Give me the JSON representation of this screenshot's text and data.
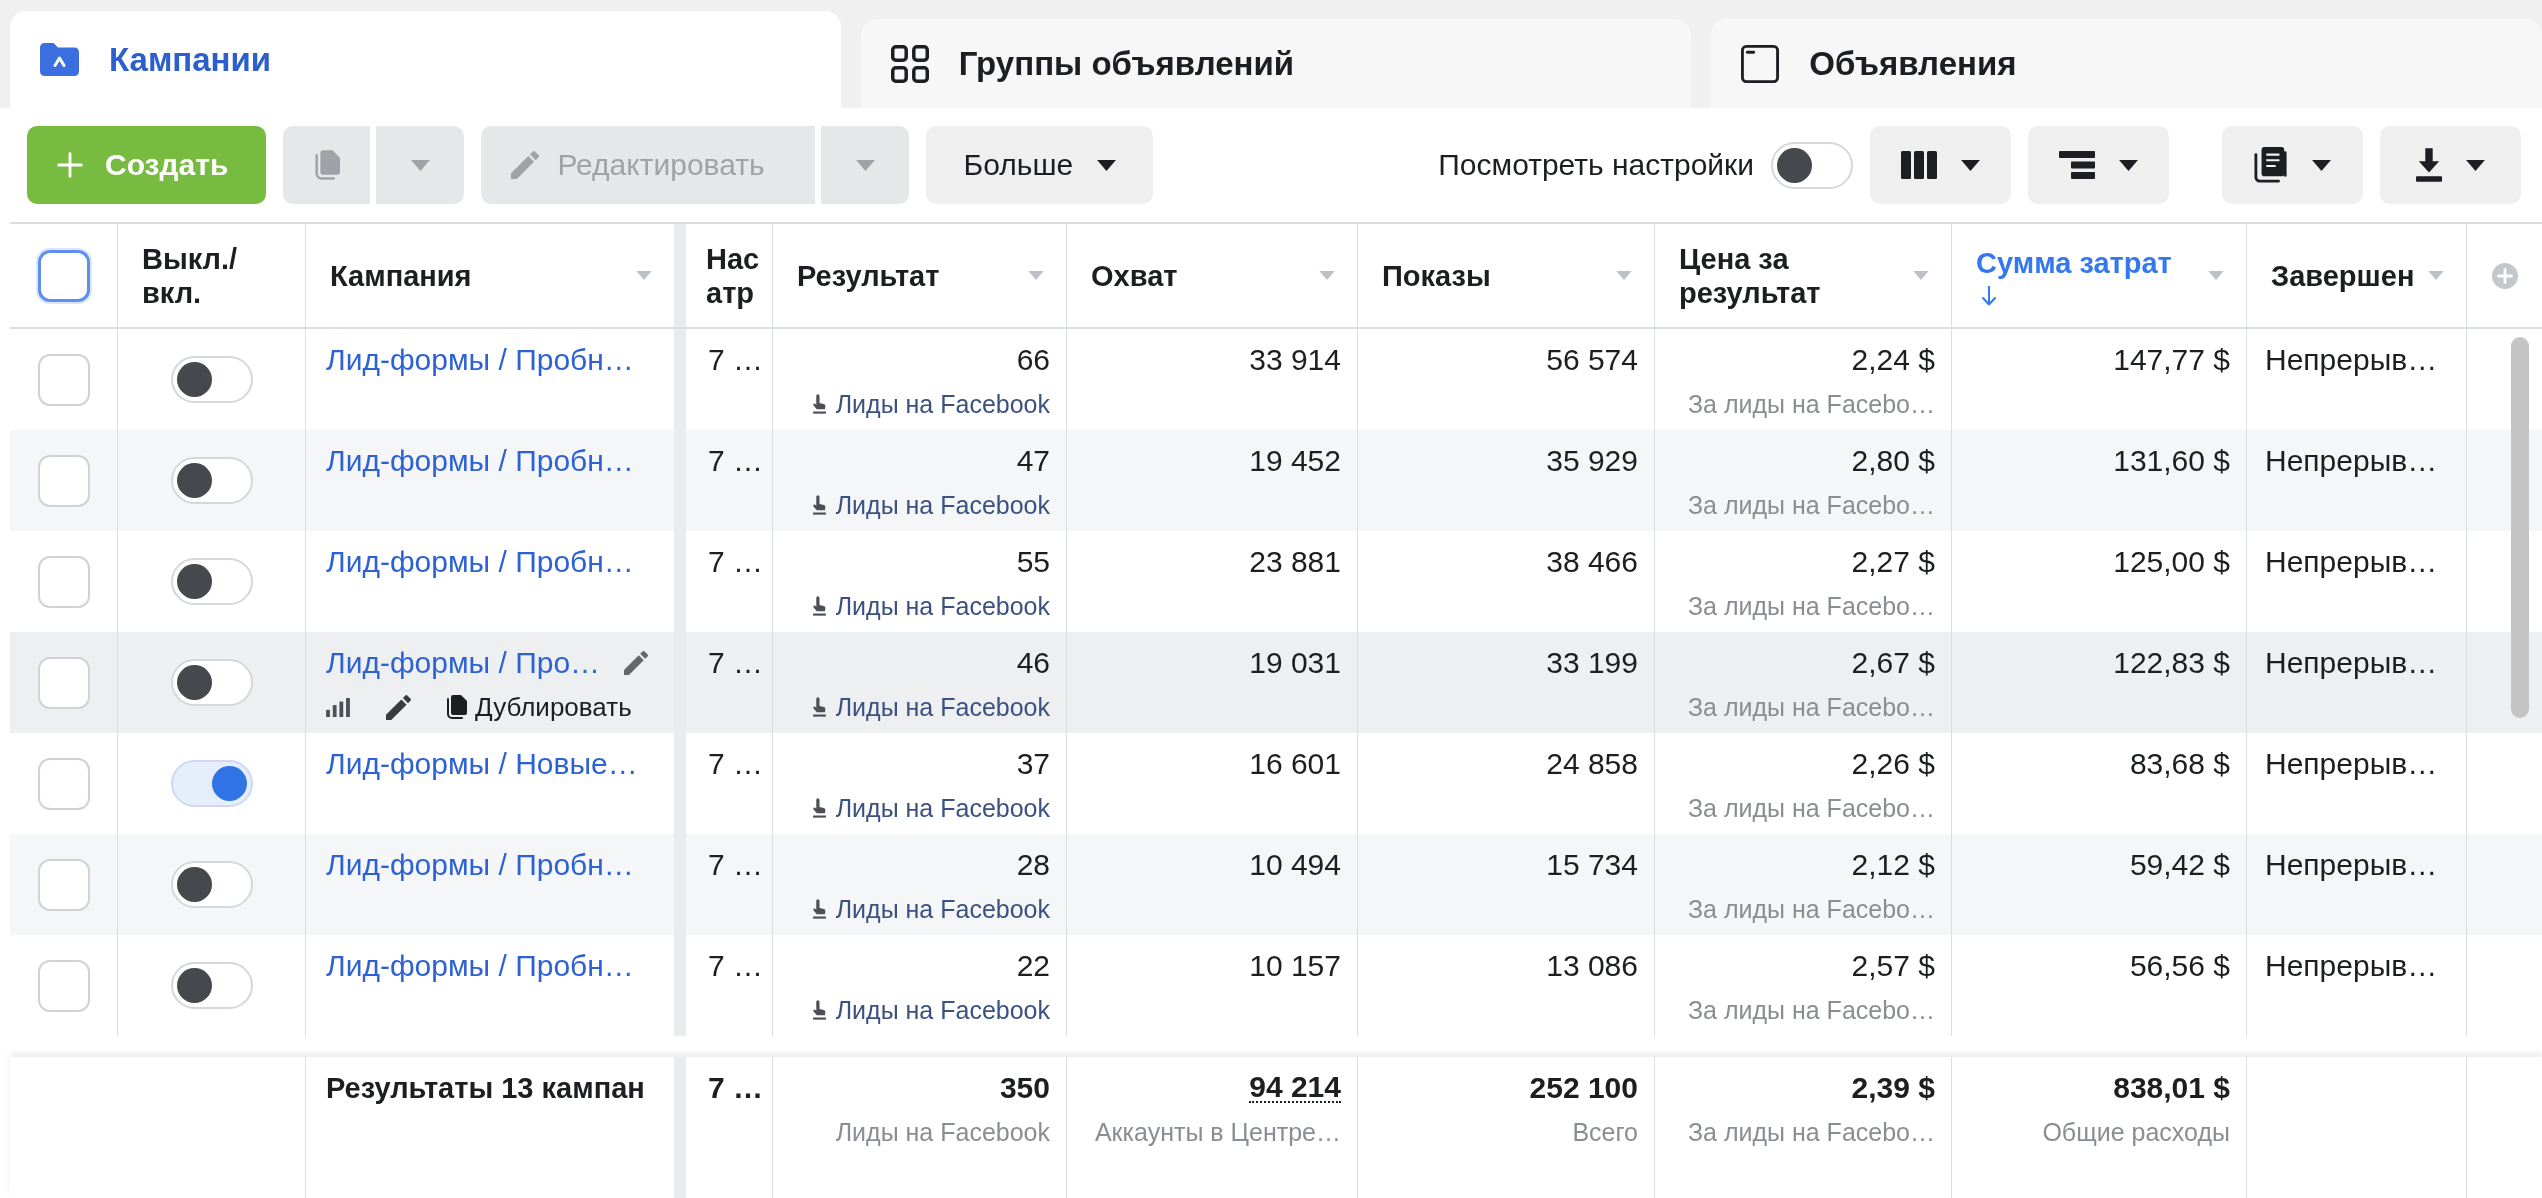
{
  "tabs": [
    {
      "label": "Кампании",
      "selected": true
    },
    {
      "label": "Группы объявлений",
      "selected": false
    },
    {
      "label": "Объявления",
      "selected": false
    }
  ],
  "toolbar": {
    "create_button": {
      "label": "Создать"
    },
    "copy_button": {
      "disabled": true
    },
    "edit_button": {
      "label": "Редактировать",
      "disabled": true
    },
    "more_button": {
      "label": "Больше"
    },
    "view_settings": {
      "label": "Посмотреть настройки",
      "on": false
    }
  },
  "table": {
    "select_all": {
      "checked": false,
      "focused": true
    },
    "columns": [
      {
        "label": "Выкл./ вкл.",
        "kind": "toggle",
        "sorted": false
      },
      {
        "label": "Кампания",
        "kind": "name",
        "sorted": false
      },
      {
        "label": "Нас атр",
        "kind": "cut",
        "sorted": false
      },
      {
        "label": "Результат",
        "kind": "metric",
        "sorted": false
      },
      {
        "label": "Охват",
        "kind": "metric",
        "sorted": false
      },
      {
        "label": "Показы",
        "kind": "metric",
        "sorted": false
      },
      {
        "label": "Цена за результат",
        "kind": "metric",
        "sorted": false
      },
      {
        "label": "Сумма затрат",
        "kind": "metric",
        "sorted": true
      },
      {
        "label": "Завершен",
        "kind": "text",
        "sorted": false
      }
    ],
    "rows": [
      {
        "selected": false,
        "on": false,
        "hovered": false,
        "name": "Лид-формы / Пробн…",
        "column_4": "7 …",
        "result": "66",
        "result_type": "Лиды на Facebook",
        "reach": "33 914",
        "impressions": "56 574",
        "cost_per_result": "2,24 $",
        "cost_type": "За лиды на Facebo…",
        "spend": "147,77 $",
        "column_10": "Непрерыв…"
      },
      {
        "selected": false,
        "on": false,
        "hovered": false,
        "name": "Лид-формы / Пробн…",
        "column_4": "7 …",
        "result": "47",
        "result_type": "Лиды на Facebook",
        "reach": "19 452",
        "impressions": "35 929",
        "cost_per_result": "2,80 $",
        "cost_type": "За лиды на Facebo…",
        "spend": "131,60 $",
        "column_10": "Непрерыв…"
      },
      {
        "selected": false,
        "on": false,
        "hovered": false,
        "name": "Лид-формы / Пробн…",
        "column_4": "7 …",
        "result": "55",
        "result_type": "Лиды на Facebook",
        "reach": "23 881",
        "impressions": "38 466",
        "cost_per_result": "2,27 $",
        "cost_type": "За лиды на Facebo…",
        "spend": "125,00 $",
        "column_10": "Непрерыв…"
      },
      {
        "selected": false,
        "on": false,
        "hovered": true,
        "name": "Лид-формы / Про…",
        "duplicate_label": "Дублировать",
        "column_4": "7 …",
        "result": "46",
        "result_type": "Лиды на Facebook",
        "reach": "19 031",
        "impressions": "33 199",
        "cost_per_result": "2,67 $",
        "cost_type": "За лиды на Facebo…",
        "spend": "122,83 $",
        "column_10": "Непрерыв…"
      },
      {
        "selected": false,
        "on": true,
        "hovered": false,
        "name": "Лид-формы / Новые…",
        "column_4": "7 …",
        "result": "37",
        "result_type": "Лиды на Facebook",
        "reach": "16 601",
        "impressions": "24 858",
        "cost_per_result": "2,26 $",
        "cost_type": "За лиды на Facebo…",
        "spend": "83,68 $",
        "column_10": "Непрерыв…"
      },
      {
        "selected": false,
        "on": false,
        "hovered": false,
        "name": "Лид-формы / Пробн…",
        "column_4": "7 …",
        "result": "28",
        "result_type": "Лиды на Facebook",
        "reach": "10 494",
        "impressions": "15 734",
        "cost_per_result": "2,12 $",
        "cost_type": "За лиды на Facebo…",
        "spend": "59,42 $",
        "column_10": "Непрерыв…"
      },
      {
        "selected": false,
        "on": false,
        "hovered": false,
        "name": "Лид-формы / Пробн…",
        "column_4": "7 …",
        "result": "22",
        "result_type": "Лиды на Facebook",
        "reach": "10 157",
        "impressions": "13 086",
        "cost_per_result": "2,57 $",
        "cost_type": "За лиды на Facebo…",
        "spend": "56,56 $",
        "column_10": "Непрерыв…"
      }
    ],
    "totals": {
      "label": "Результаты 13 кампан",
      "column_4": "7 …",
      "result": "350",
      "result_note": "Лиды на Facebook",
      "reach": "94 214",
      "reach_note": "Аккаунты в Центре…",
      "impressions": "252 100",
      "impressions_note": "Всего",
      "cost_per_result": "2,39 $",
      "cost_note": "За лиды на Facebo…",
      "spend": "838,01 $",
      "spend_note": "Общие расходы"
    }
  }
}
